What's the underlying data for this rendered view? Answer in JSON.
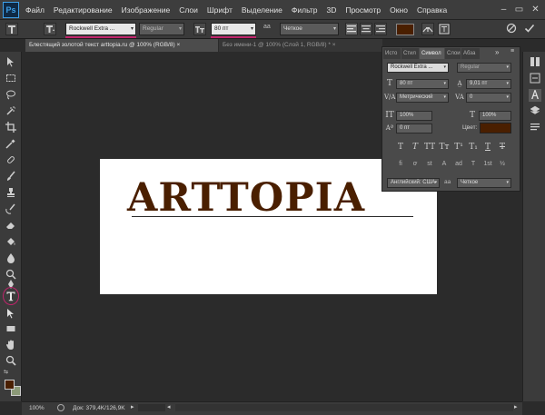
{
  "app": {
    "logo": "Ps"
  },
  "menu": [
    "Файл",
    "Редактирование",
    "Изображение",
    "Слои",
    "Шрифт",
    "Выделение",
    "Фильтр",
    "3D",
    "Просмотр",
    "Окно",
    "Справка"
  ],
  "window_controls": {
    "minimize": "–",
    "maximize": "▭",
    "close": "✕"
  },
  "options_bar": {
    "font_family": "Rockwell Extra ...",
    "font_style": "Regular",
    "font_size": "80 пт",
    "antialias_icon_text": "aa",
    "antialias": "Четкое",
    "text_color": "#4a1f00"
  },
  "tabs": [
    {
      "label": "Блестящий золотой текст  arttopia.ru @ 100% (RGB/8)",
      "close": "×"
    },
    {
      "label": "Без имени-1 @ 100% (Слой 1, RGB/8) *",
      "close": "×"
    }
  ],
  "canvas_text": "ARTTOPIA",
  "character_panel": {
    "tabs": [
      "Исто",
      "Стил",
      "Символ",
      "Слои",
      "Абза"
    ],
    "collapse_arrows": "»",
    "font_family": "Rockwell Extra ...",
    "font_style": "Regular",
    "font_size": "80 пт",
    "leading": "9,01 пт",
    "kerning": "Метрический",
    "tracking": "0",
    "vertical_scale": "100%",
    "horizontal_scale": "100%",
    "baseline_shift": "0 пт",
    "color_label": "Цвет:",
    "color": "#4a1f00",
    "style_buttons": [
      "T",
      "T",
      "TT",
      "Tт",
      "T¹",
      "T₁",
      "T",
      "T"
    ],
    "opentype_buttons": [
      "fi",
      "ơ",
      "st",
      "A",
      "ad",
      "T",
      "1st",
      "½"
    ],
    "language": "Английский: США",
    "antialias_label": "aa",
    "antialias": "Четкое"
  },
  "status_bar": {
    "zoom": "100%",
    "doc_info": "Док: 379,4K/126,9K"
  },
  "colors": {
    "accent_annotation": "#c0246b",
    "foreground": "#4a1f00",
    "background": "#8c9a78"
  }
}
